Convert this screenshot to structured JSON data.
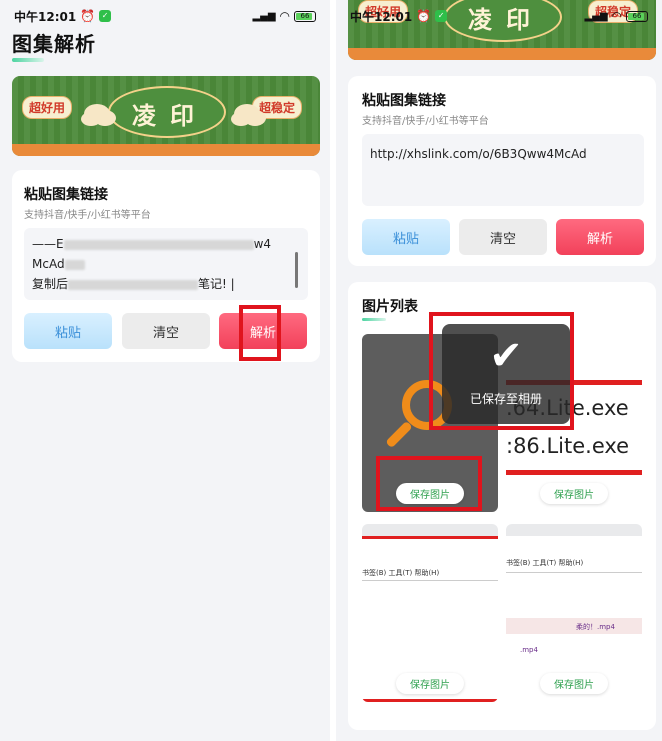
{
  "left": {
    "status": {
      "time": "中午12:01",
      "battery": "66"
    },
    "page_title": "图集解析",
    "banner": {
      "main": "凌印",
      "tag_left": "超好用",
      "tag_right": "超稳定"
    },
    "card": {
      "title": "粘贴图集链接",
      "subtitle": "支持抖音/快手/小红书等平台",
      "text_line1_start": "——E",
      "text_line1_end": "w4",
      "text_line2": "McAd",
      "text_line3_start": "复制后",
      "text_line3_end": "笔记! |"
    },
    "buttons": {
      "paste": "粘贴",
      "clear": "清空",
      "parse": "解析"
    }
  },
  "right": {
    "status": {
      "time": "中午12:01",
      "battery": "66"
    },
    "banner": {
      "main": "凌印",
      "tag_left": "超好用",
      "tag_right": "超稳定"
    },
    "card": {
      "title": "粘贴图集链接",
      "subtitle": "支持抖音/快手/小红书等平台",
      "url": "http://xhslink.com/o/6B3Qww4McAd"
    },
    "buttons": {
      "paste": "粘贴",
      "clear": "清空",
      "parse": "解析"
    },
    "images": {
      "title": "图片列表",
      "save_label": "保存图片",
      "toast": "已保存至相册",
      "exe1": ".64.Lite.exe",
      "exe2": ":86.Lite.exe",
      "menu": "书签(B)   工具(T)   帮助(H)",
      "mp4_a": "柔的！.mp4",
      "mp4_b": ".mp4"
    }
  },
  "colors": {
    "accent_red": "#e0141d",
    "parse": "#f2415a",
    "paste": "#3a8fd8",
    "save_green": "#2ea04e"
  }
}
